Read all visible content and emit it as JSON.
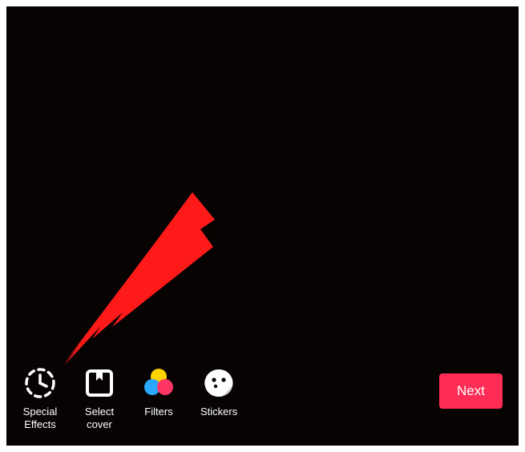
{
  "toolbar": {
    "items": [
      {
        "label": "Special\nEffects",
        "icon": "clock-dashed-icon"
      },
      {
        "label": "Select\ncover",
        "icon": "bookmark-square-icon"
      },
      {
        "label": "Filters",
        "icon": "color-circles-icon"
      },
      {
        "label": "Stickers",
        "icon": "sticker-face-icon"
      }
    ],
    "next_label": "Next"
  },
  "annotation": {
    "present": true,
    "type": "red-arrow",
    "color": "#ff1a1a",
    "points_to": "special-effects-button"
  },
  "colors": {
    "background": "#070303",
    "accent": "#ff2d55",
    "text": "#ffffff",
    "arrow": "#ff1a1a"
  }
}
